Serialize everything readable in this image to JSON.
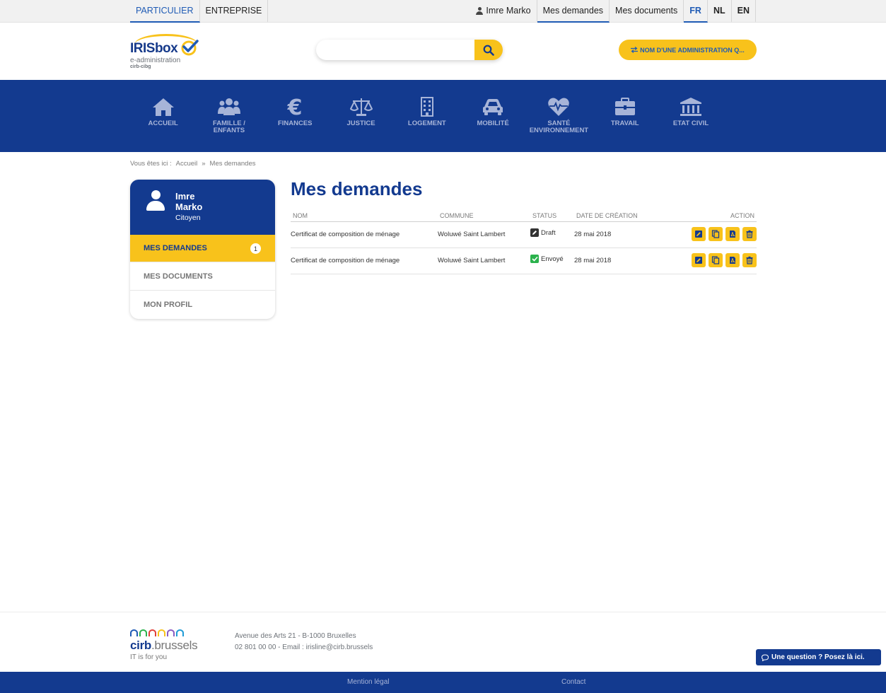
{
  "topbar": {
    "left": [
      {
        "label": "PARTICULIER",
        "active": true
      },
      {
        "label": "ENTREPRISE",
        "active": false
      }
    ],
    "user": "Imre Marko",
    "links": [
      {
        "label": "Mes demandes",
        "active": true
      },
      {
        "label": "Mes documents",
        "active": false
      }
    ],
    "langs": [
      {
        "label": "FR",
        "active": true
      },
      {
        "label": "NL",
        "active": false
      },
      {
        "label": "EN",
        "active": false
      }
    ]
  },
  "header": {
    "logo_title": "IRISbox",
    "logo_sub": "e-administration",
    "logo_sub2": "cirb-cibg",
    "search_placeholder": "",
    "admin_button": "NOM D'UNE ADMINISTRATION Q..."
  },
  "nav": [
    {
      "label": "ACCUEIL",
      "icon": "home-icon"
    },
    {
      "label": "FAMILLE /\nENFANTS",
      "icon": "family-icon"
    },
    {
      "label": "FINANCES",
      "icon": "euro-icon"
    },
    {
      "label": "JUSTICE",
      "icon": "scales-icon"
    },
    {
      "label": "LOGEMENT",
      "icon": "building-icon"
    },
    {
      "label": "MOBILITÉ",
      "icon": "car-icon"
    },
    {
      "label": "SANTÉ\nENVIRONNEMENT",
      "icon": "heart-icon"
    },
    {
      "label": "TRAVAIL",
      "icon": "briefcase-icon"
    },
    {
      "label": "ETAT CIVIL",
      "icon": "institution-icon"
    }
  ],
  "breadcrumb": {
    "prefix": "Vous êtes ici :",
    "home": "Accueil",
    "sep": "»",
    "current": "Mes demandes"
  },
  "sidebar": {
    "first_name": "Imre",
    "last_name": "Marko",
    "role": "Citoyen",
    "items": [
      {
        "label": "MES DEMANDES",
        "active": true,
        "badge": "1"
      },
      {
        "label": "MES DOCUMENTS",
        "active": false
      },
      {
        "label": "MON PROFIL",
        "active": false
      }
    ]
  },
  "main": {
    "title": "Mes demandes",
    "columns": [
      "NOM",
      "COMMUNE",
      "STATUS",
      "DATE DE CRÉATION",
      "ACTION"
    ],
    "rows": [
      {
        "nom": "Certificat de composition de ménage",
        "commune": "Woluwé Saint Lambert",
        "status": "Draft",
        "date": "28 mai 2018"
      },
      {
        "nom": "Certificat de composition de ménage",
        "commune": "Woluwé Saint Lambert",
        "status": "Envoyé",
        "date": "28 mai 2018"
      }
    ]
  },
  "footer": {
    "brand_main": "cirb",
    "brand_rest": ".brussels",
    "tagline": "IT is for you",
    "address": "Avenue des Arts 21 - B-1000 Bruxelles",
    "contact": "02 801 00 00 - Email : irisline@cirb.brussels",
    "question_button": "Une question ? Posez là ici.",
    "bottom_links": [
      "Mention légal",
      "Contact"
    ]
  },
  "colors": {
    "brand_blue": "#133a8f",
    "accent_yellow": "#f8c21b",
    "link_blue": "#1f5bb5",
    "draft": "#333333",
    "sent": "#2bb24c"
  }
}
